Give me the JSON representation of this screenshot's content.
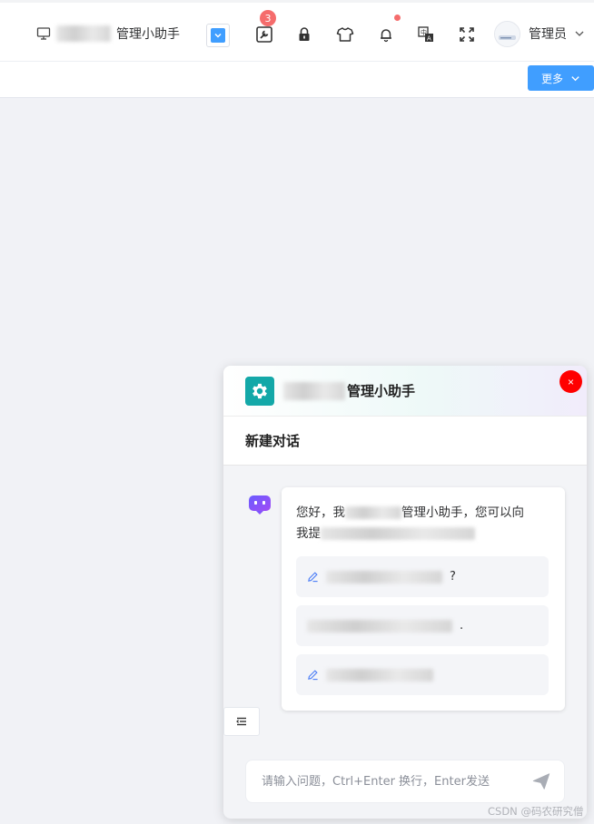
{
  "header": {
    "system_name": "管理小助手",
    "notification_count": "3",
    "user_name": "管理员"
  },
  "toolbar": {
    "more_label": "更多"
  },
  "assistant": {
    "title": "管理小助手",
    "new_chat_label": "新建对话",
    "greeting_prefix": "您好，我",
    "greeting_mid": "管理小助手，您可以向",
    "greeting_line2": "我提",
    "suggestions": [
      "?",
      ".",
      ""
    ],
    "input_placeholder": "请输入问题，Ctrl+Enter 换行，Enter发送"
  },
  "watermark": "CSDN @码农研究僧",
  "colors": {
    "primary": "#409eff",
    "badge": "#f56c6c",
    "logo": "#13a8a8",
    "close": "#ff0000"
  }
}
